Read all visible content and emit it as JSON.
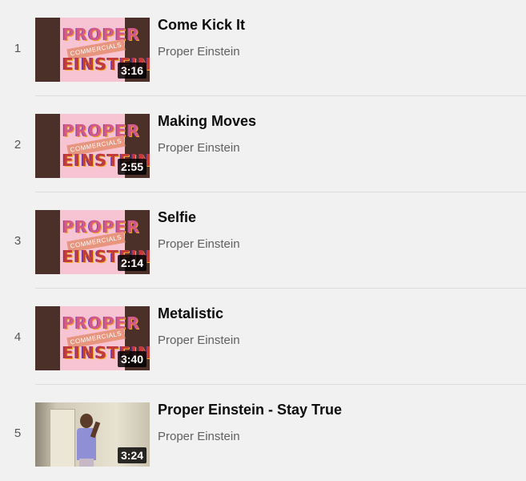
{
  "playlist": {
    "items": [
      {
        "index": "1",
        "title": "Come Kick It",
        "channel": "Proper Einstein",
        "duration": "3:16",
        "thumbnail": "proper-einstein-commercials-logo"
      },
      {
        "index": "2",
        "title": "Making Moves",
        "channel": "Proper Einstein",
        "duration": "2:55",
        "thumbnail": "proper-einstein-commercials-logo"
      },
      {
        "index": "3",
        "title": "Selfie",
        "channel": "Proper Einstein",
        "duration": "2:14",
        "thumbnail": "proper-einstein-commercials-logo"
      },
      {
        "index": "4",
        "title": "Metalistic",
        "channel": "Proper Einstein",
        "duration": "3:40",
        "thumbnail": "proper-einstein-commercials-logo"
      },
      {
        "index": "5",
        "title": "Proper Einstein - Stay True",
        "channel": "Proper Einstein",
        "duration": "3:24",
        "thumbnail": "person-photo"
      }
    ],
    "logo_text": {
      "line1": "PROPER",
      "banner": "COMMERCIALS",
      "line2": "EINSTEIN"
    }
  },
  "colors": {
    "background": "#f1f1f1",
    "thumb_frame": "#4a3029",
    "thumb_pink": "#f7c4d4"
  }
}
